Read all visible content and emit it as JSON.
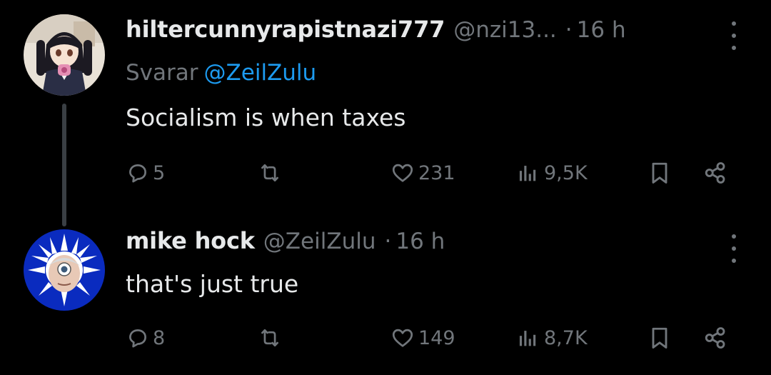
{
  "posts": [
    {
      "display_name": "hiltercunnyrapistnazi777",
      "handle": "@nzi13...",
      "separator": "·",
      "time": "16 h",
      "reply_prefix": "Svarar",
      "reply_mention": "@ZeilZulu",
      "text": "Socialism is when taxes",
      "replies": "5",
      "likes": "231",
      "views": "9,5K"
    },
    {
      "display_name": "mike hock",
      "handle": "@ZeilZulu",
      "separator": "·",
      "time": "16 h",
      "text": "that's just true",
      "replies": "8",
      "likes": "149",
      "views": "8,7K"
    }
  ],
  "icons": {
    "more": "more-vertical-icon",
    "reply": "speech-bubble-icon",
    "repost": "repost-arrows-icon",
    "like": "heart-icon",
    "views": "bar-chart-icon",
    "bookmark": "bookmark-icon",
    "share": "share-nodes-icon"
  },
  "colors": {
    "background": "#000000",
    "primary_text": "#e7e9ea",
    "secondary_text": "#71767b",
    "link": "#1d9bf0",
    "thread_line": "#3a3f44"
  }
}
